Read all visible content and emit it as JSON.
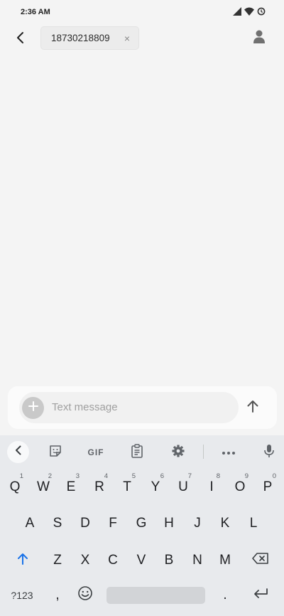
{
  "status_bar": {
    "time": "2:36 AM",
    "icons": [
      "signal-icon",
      "wifi-icon",
      "data-saver-icon"
    ]
  },
  "app_bar": {
    "back_icon": "back-arrow-icon",
    "recipient": "18730218809",
    "remove_recipient": "×",
    "contact_icon": "person-icon"
  },
  "compose": {
    "placeholder": "Text message",
    "attach_icon": "plus-icon",
    "send_icon": "arrow-up-icon"
  },
  "keyboard": {
    "toolbar": {
      "collapse_icon": "chevron-left-icon",
      "sticker_icon": "sticker-icon",
      "gif_label": "GIF",
      "clipboard_icon": "clipboard-icon",
      "settings_icon": "gear-icon",
      "more_icon": "more-icon",
      "mic_icon": "microphone-icon"
    },
    "row1": [
      {
        "label": "Q",
        "hint": "1"
      },
      {
        "label": "W",
        "hint": "2"
      },
      {
        "label": "E",
        "hint": "3"
      },
      {
        "label": "R",
        "hint": "4"
      },
      {
        "label": "T",
        "hint": "5"
      },
      {
        "label": "Y",
        "hint": "6"
      },
      {
        "label": "U",
        "hint": "7"
      },
      {
        "label": "I",
        "hint": "8"
      },
      {
        "label": "O",
        "hint": "9"
      },
      {
        "label": "P",
        "hint": "0"
      }
    ],
    "row2": [
      "A",
      "S",
      "D",
      "F",
      "G",
      "H",
      "J",
      "K",
      "L"
    ],
    "row3": [
      "Z",
      "X",
      "C",
      "V",
      "B",
      "N",
      "M"
    ],
    "row4": {
      "symbols_label": "?123",
      "comma_label": ",",
      "period_label": ".",
      "emoji_icon": "emoji-icon",
      "enter_icon": "enter-icon"
    },
    "shift_icon": "shift-icon",
    "backspace_icon": "backspace-icon",
    "accent_color": "#1a73e8"
  }
}
